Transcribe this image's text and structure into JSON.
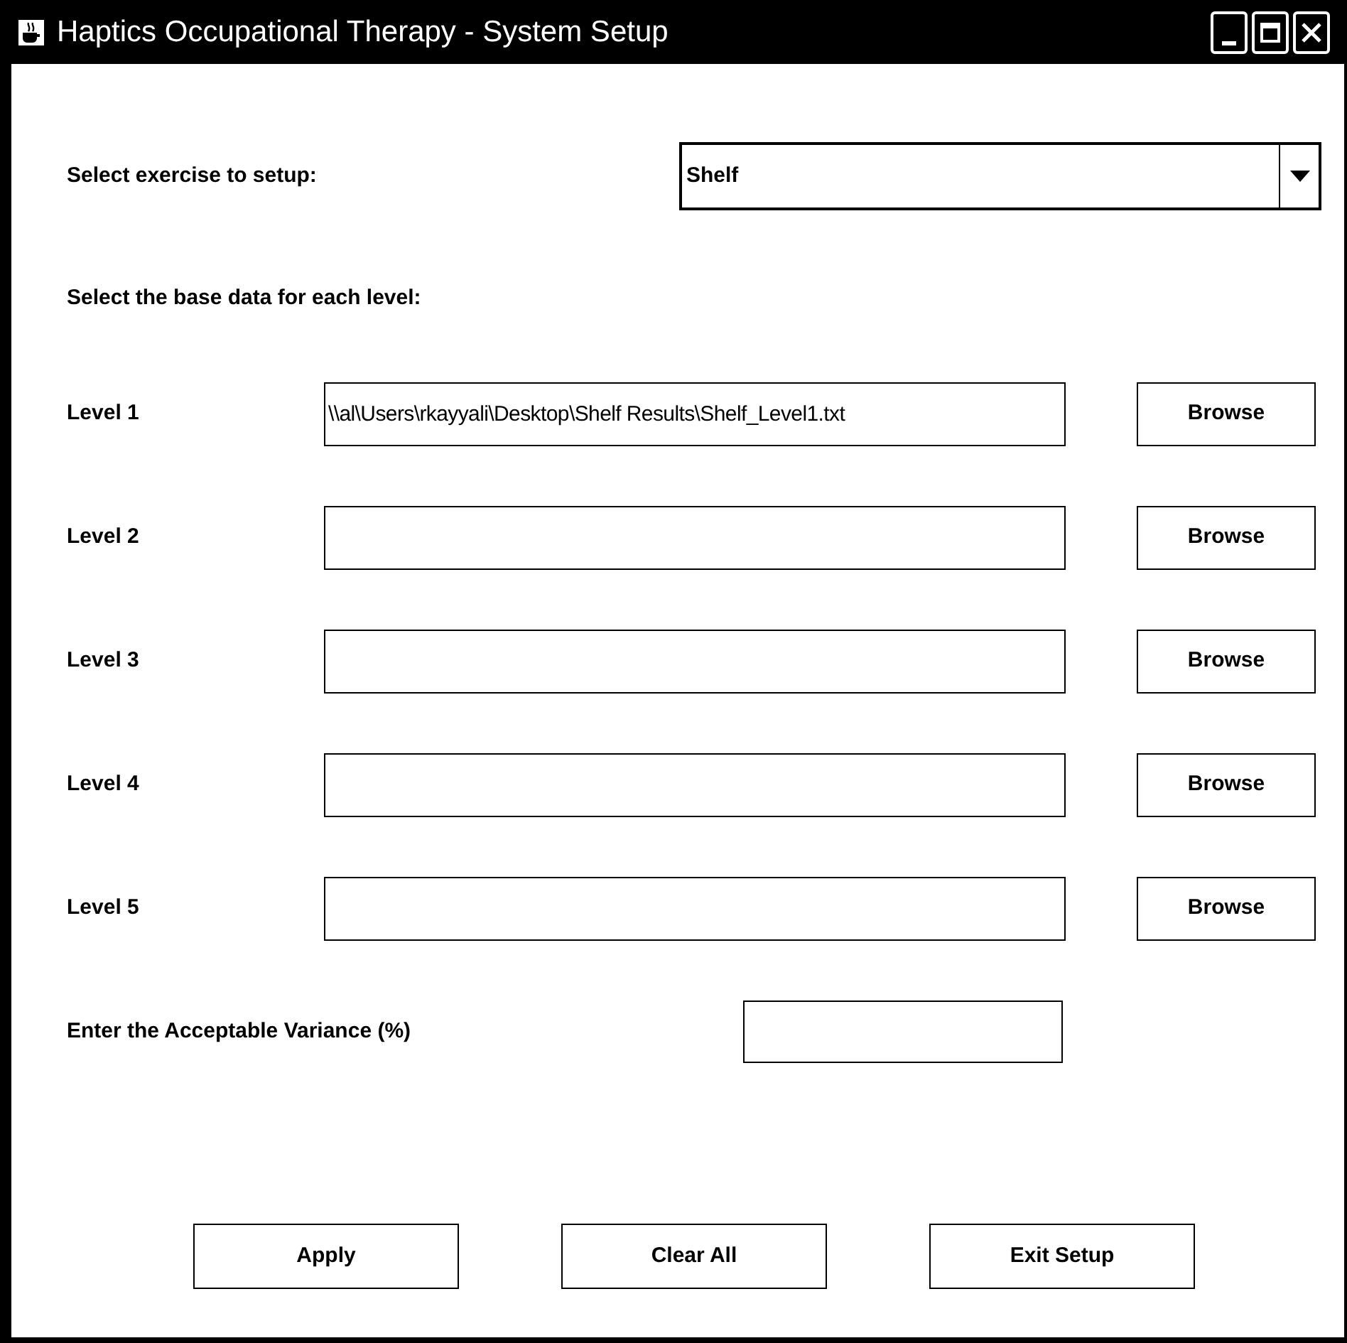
{
  "window": {
    "title": "Haptics Occupational Therapy - System Setup"
  },
  "exercise": {
    "label": "Select exercise to setup:",
    "value": "Shelf"
  },
  "base_data_label": "Select the base data for each level:",
  "levels": [
    {
      "label": "Level 1",
      "value": "\\\\al\\Users\\rkayyali\\Desktop\\Shelf Results\\Shelf_Level1.txt",
      "button": "Browse"
    },
    {
      "label": "Level 2",
      "button": "Browse"
    },
    {
      "label": "Level 3",
      "button": "Browse"
    },
    {
      "label": "Level 4",
      "button": "Browse"
    },
    {
      "label": "Level 5",
      "button": "Browse"
    }
  ],
  "variance": {
    "label": "Enter the Acceptable Variance (%)"
  },
  "buttons": [
    "Apply",
    "Clear All",
    "Exit Setup"
  ]
}
